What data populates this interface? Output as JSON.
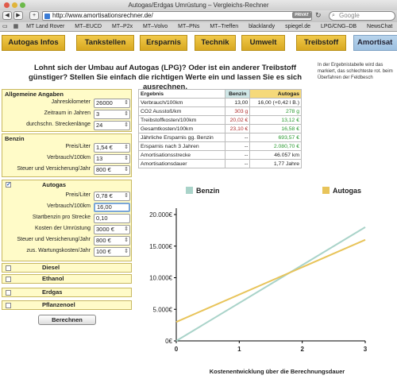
{
  "browser": {
    "title": "Autogas/Erdgas Umrüstung – Vergleichs-Rechner",
    "url": "http://www.amortisationsrechner.de/",
    "privat_label": "PRIVAT",
    "search_placeholder": "Google",
    "bookmarks": [
      "MT Land Rover",
      "MT–EUCD",
      "MT–P2x",
      "MT–Volvo",
      "MT–PNs",
      "MT–Treffen",
      "blacklandy",
      "spiegel.de",
      "LPG/CNG–DB",
      "NewsChat"
    ]
  },
  "nav": {
    "tabs": [
      "Autogas Infos",
      "Tankstellen",
      "Ersparnis",
      "Technik",
      "Umwelt",
      "Treibstoff",
      "Amortisat"
    ]
  },
  "question": "Lohnt sich der Umbau auf Autogas (LPG)? Oder ist ein anderer Treibstoff günstiger? Stellen Sie einfach die richtigen Werte ein und lassen Sie es sich ausrechnen.",
  "sidenote": "In der Ergebnistabelle wird das markiert, das schlechteste rot. beim Überfahren der Feldbesch",
  "form": {
    "general": {
      "title": "Allgemeine Angaben",
      "rows": [
        {
          "label": "Jahreskilometer",
          "value": "26000"
        },
        {
          "label": "Zeitraum in Jahren",
          "value": "3"
        },
        {
          "label": "durchschn. Streckenlänge",
          "value": "24"
        }
      ]
    },
    "benzin": {
      "title": "Benzin",
      "rows": [
        {
          "label": "Preis/Liter",
          "value": "1,54 €"
        },
        {
          "label": "Verbrauch/100km",
          "value": "13"
        },
        {
          "label": "Steuer und Versicherung/Jahr",
          "value": "800 €"
        }
      ]
    },
    "autogas": {
      "title": "Autogas",
      "checked_mark": "✓",
      "rows": [
        {
          "label": "Preis/Liter",
          "value": "0,78 €"
        },
        {
          "label": "Verbrauch/100km",
          "value": "16,00"
        },
        {
          "label": "Startbenzin pro Strecke",
          "value": "0,10"
        },
        {
          "label": "Kosten der Umrüstung",
          "value": "3000 €"
        },
        {
          "label": "Steuer und Versicherung/Jahr",
          "value": "800 €"
        },
        {
          "label": "zus. Wartungskosten/Jahr",
          "value": "100 €"
        }
      ]
    },
    "others": [
      "Diesel",
      "Ethanol",
      "Erdgas",
      "Pflanzenoel"
    ],
    "calc_label": "Berechnen"
  },
  "results": {
    "headers": [
      "Ergebnis",
      "Benzin",
      "Autogas"
    ],
    "rows": [
      {
        "label": "Verbrauch/100km",
        "benzin": "13,00",
        "autogas": "16,00 (+0,42 l B.)"
      },
      {
        "label": "CO2 Ausstoß/km",
        "benzin": "303 g",
        "autogas": "278 g"
      },
      {
        "label": "Treibstoffkosten/100km",
        "benzin": "20,02 €",
        "autogas": "13,12 €"
      },
      {
        "label": "Gesamtkosten/100km",
        "benzin": "23,10 €",
        "autogas": "16,58 €"
      },
      {
        "label": "Jährliche Ersparnis gg. Benzin",
        "benzin": "--",
        "autogas": "693,57 €"
      },
      {
        "label": "Ersparnis nach 3 Jahren",
        "benzin": "--",
        "autogas": "2.080,70 €"
      },
      {
        "label": "Amortisationsstrecke",
        "benzin": "--",
        "autogas": "46.057 km"
      },
      {
        "label": "Amortisationsdauer",
        "benzin": "--",
        "autogas": "1,77 Jahre"
      }
    ]
  },
  "colors": {
    "benzin": "#a9d3c9",
    "autogas": "#e8c45a",
    "worst": "#b03030",
    "best": "#2a9a30"
  },
  "chart_data": {
    "type": "line",
    "title": "",
    "xlabel": "Kostenentwicklung über die Berechnungsdauer",
    "ylabel": "",
    "x": [
      0,
      3
    ],
    "xticks": [
      "0",
      "1",
      "2",
      "3"
    ],
    "yticks": [
      "0€",
      "5.000€",
      "10.000€",
      "15.000€",
      "20.000€"
    ],
    "ylim": [
      0,
      20000
    ],
    "xlim": [
      0,
      3
    ],
    "legend_position": "top",
    "series": [
      {
        "name": "Benzin",
        "values": [
          0,
          18000
        ]
      },
      {
        "name": "Autogas",
        "values": [
          3000,
          16000
        ]
      }
    ]
  }
}
